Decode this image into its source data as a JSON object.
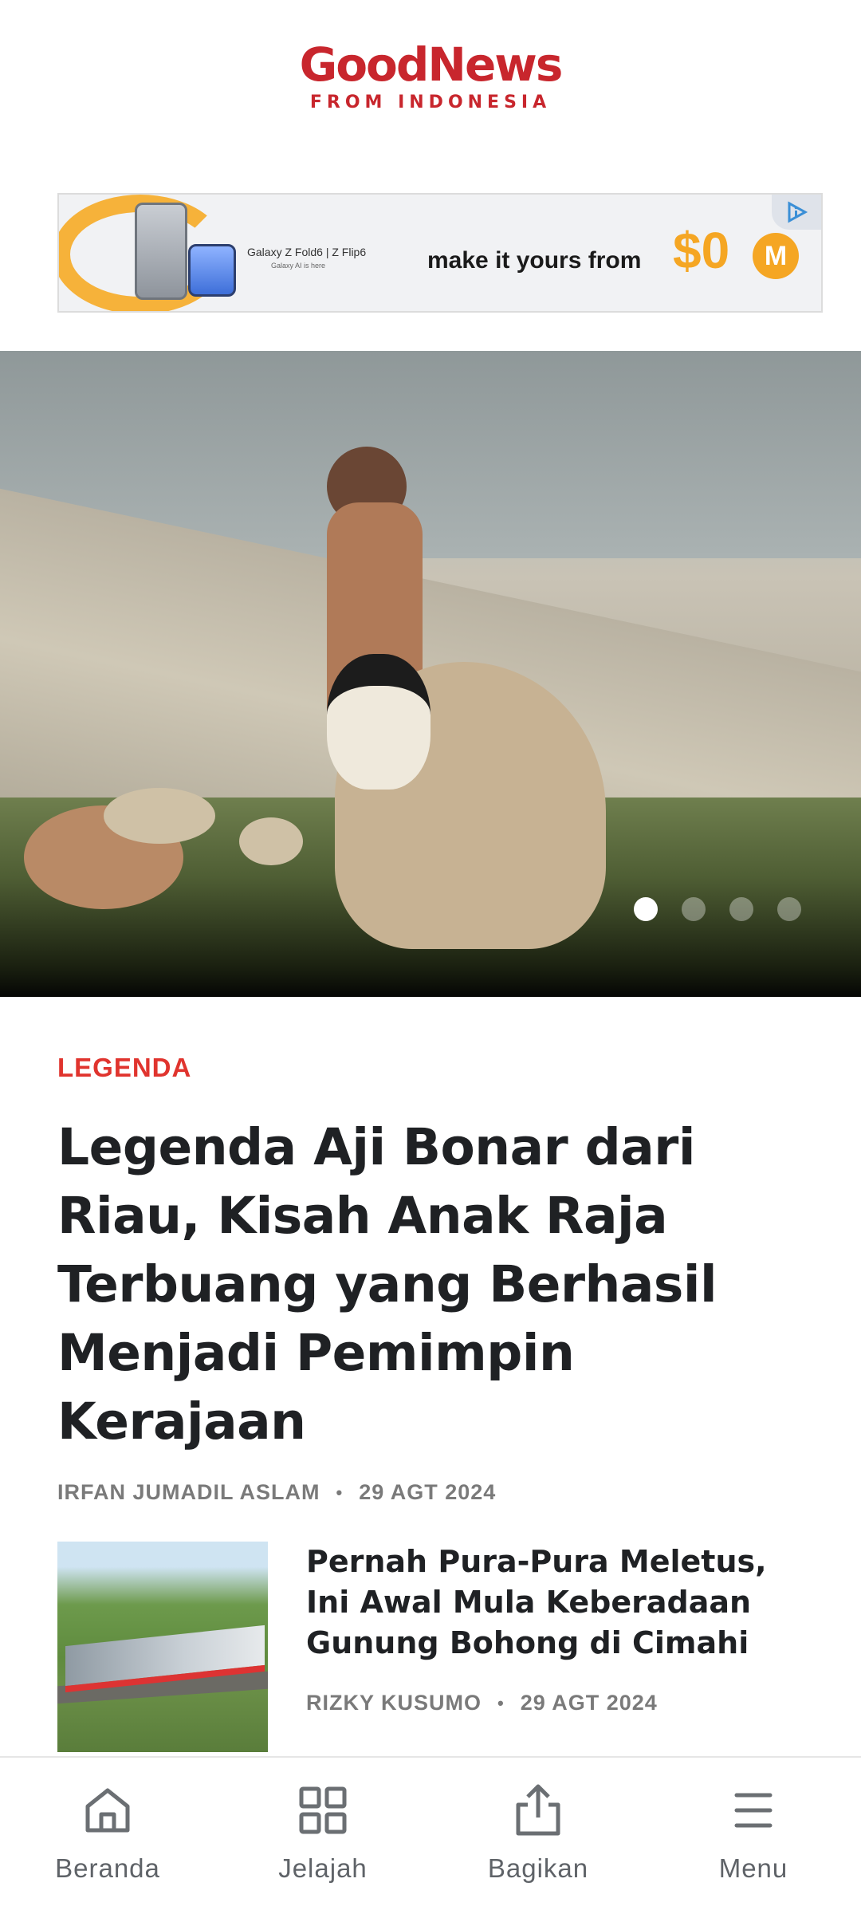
{
  "header": {
    "logo_main": "GoodNews",
    "logo_sub": "FROM INDONESIA"
  },
  "ad": {
    "product": "Galaxy Z Fold6 | Z Flip6",
    "product_sub": "Galaxy AI is here",
    "headline": "make it yours from",
    "price": "$0",
    "badge": "M",
    "adchoices_icon": "adchoices-icon"
  },
  "hero": {
    "slide_count": 4,
    "active_slide": 1
  },
  "featured": {
    "category": "LEGENDA",
    "title": "Legenda Aji Bonar dari Riau, Kisah Anak Raja Terbuang yang Berhasil Menjadi Pemimpin Kerajaan",
    "author": "IRFAN JUMADIL ASLAM",
    "separator": "•",
    "date": "29 AGT 2024"
  },
  "articles": [
    {
      "title": "Pernah Pura-Pura Meletus, Ini Awal Mula Keberadaan Gunung Bohong di Cimahi",
      "author": "RIZKY KUSUMO",
      "separator": "•",
      "date": "29 AGT 2024"
    }
  ],
  "bottom_nav": {
    "items": [
      {
        "label": "Beranda",
        "icon": "home-icon"
      },
      {
        "label": "Jelajah",
        "icon": "grid-icon"
      },
      {
        "label": "Bagikan",
        "icon": "share-icon"
      },
      {
        "label": "Menu",
        "icon": "menu-icon"
      }
    ]
  },
  "colors": {
    "brand_red": "#c8262d",
    "category_red": "#e0342e",
    "meta_gray": "#7a7a7a",
    "nav_gray": "#5f6368",
    "ad_orange": "#f5a623"
  }
}
